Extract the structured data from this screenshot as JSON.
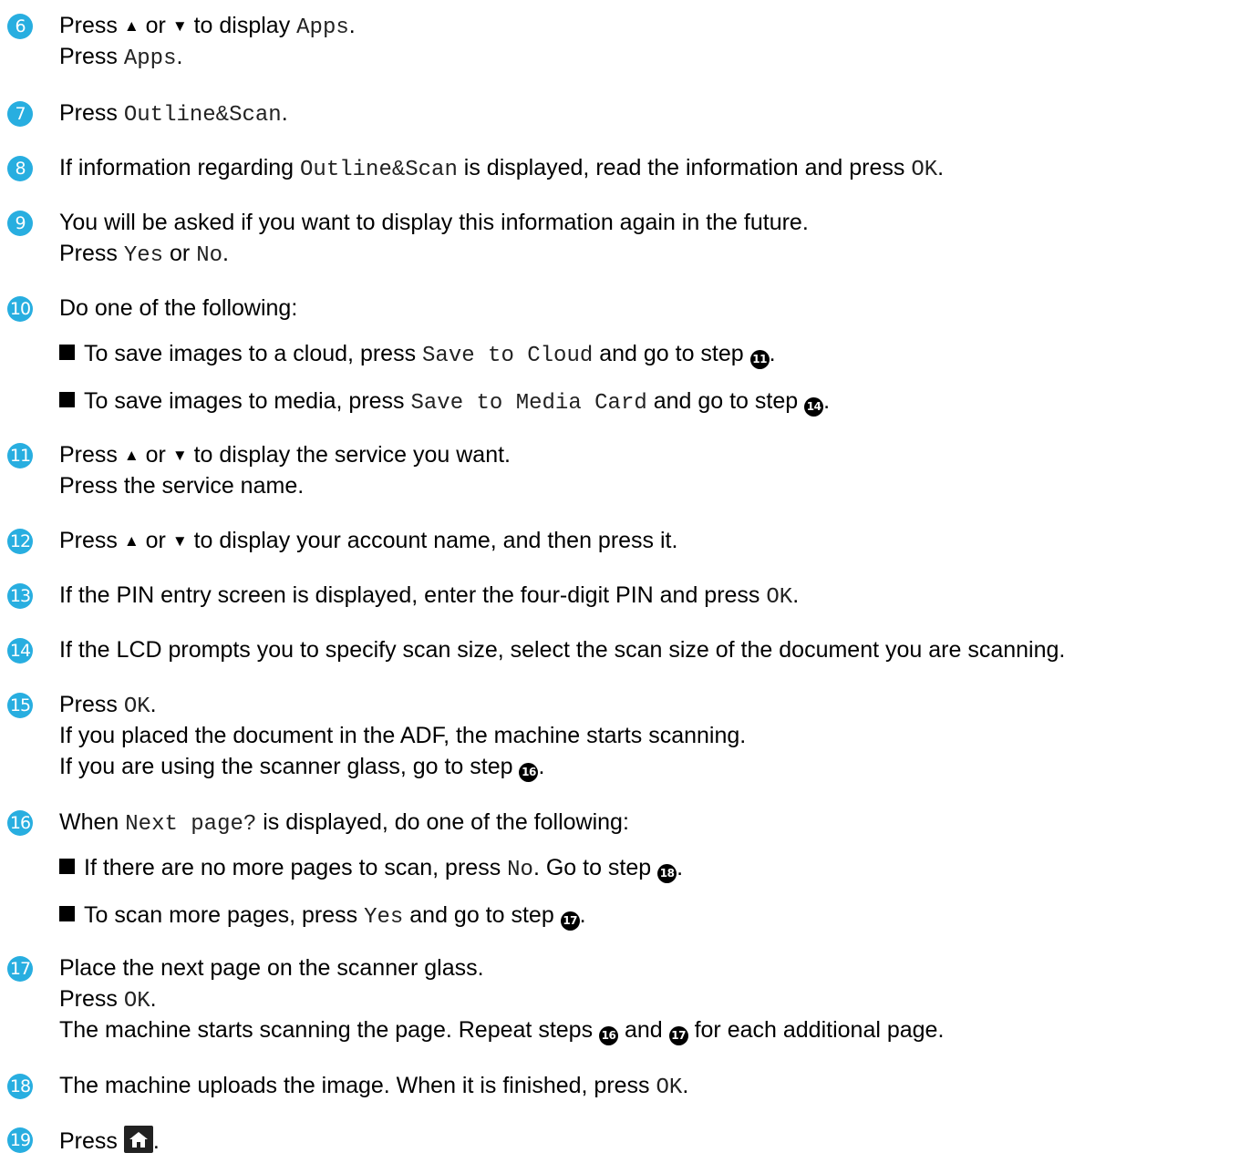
{
  "steps": {
    "s6": {
      "num": "6",
      "l1": [
        "Press ",
        "▲",
        " or ",
        "▼",
        " to display ",
        "Apps",
        "."
      ],
      "l2": [
        "Press ",
        "Apps",
        "."
      ]
    },
    "s7": {
      "num": "7",
      "l1": [
        "Press ",
        "Outline&Scan",
        "."
      ]
    },
    "s8": {
      "num": "8",
      "l1": [
        "If information regarding ",
        "Outline&Scan",
        " is displayed, read the information and press ",
        "OK",
        "."
      ]
    },
    "s9": {
      "num": "9",
      "l1": "You will be asked if you want to display this information again in the future.",
      "l2": [
        "Press ",
        "Yes",
        " or ",
        "No",
        "."
      ]
    },
    "s10": {
      "num": "10",
      "l1": "Do one of the following:",
      "b1": [
        "To save images to a cloud, press ",
        "Save to Cloud",
        " and go to step ",
        "11",
        "."
      ],
      "b2": [
        "To save images to media, press ",
        "Save to Media Card",
        " and go to step ",
        "14",
        "."
      ]
    },
    "s11": {
      "num": "11",
      "l1": [
        "Press ",
        "▲",
        " or ",
        "▼",
        " to display the service you want."
      ],
      "l2": "Press the service name."
    },
    "s12": {
      "num": "12",
      "l1": [
        "Press ",
        "▲",
        " or ",
        "▼",
        " to display your account name, and then press it."
      ]
    },
    "s13": {
      "num": "13",
      "l1": [
        "If the PIN entry screen is displayed, enter the four-digit PIN and press ",
        "OK",
        "."
      ]
    },
    "s14": {
      "num": "14",
      "l1": "If the LCD prompts you to specify scan size, select the scan size of the document you are scanning."
    },
    "s15": {
      "num": "15",
      "l1": [
        "Press ",
        "OK",
        "."
      ],
      "l2": "If you placed the document in the ADF, the machine starts scanning.",
      "l3": [
        "If you are using the scanner glass, go to step ",
        "16",
        "."
      ]
    },
    "s16": {
      "num": "16",
      "l1": [
        "When ",
        "Next page?",
        " is displayed, do one of the following:"
      ],
      "b1": [
        "If there are no more pages to scan, press ",
        "No",
        ". Go to step ",
        "18",
        "."
      ],
      "b2": [
        "To scan more pages, press ",
        "Yes",
        " and go to step ",
        "17",
        "."
      ]
    },
    "s17": {
      "num": "17",
      "l1": "Place the next page on the scanner glass.",
      "l2": [
        "Press ",
        "OK",
        "."
      ],
      "l3": [
        "The machine starts scanning the page. Repeat steps ",
        "16",
        " and ",
        "17",
        " for each additional page."
      ]
    },
    "s18": {
      "num": "18",
      "l1": [
        "The machine uploads the image. When it is finished, press ",
        "OK",
        "."
      ]
    },
    "s19": {
      "num": "19",
      "l1": [
        "Press ",
        "."
      ],
      "icon": "home-icon"
    }
  },
  "colors": {
    "badge": "#28aee0",
    "text": "#000000"
  }
}
